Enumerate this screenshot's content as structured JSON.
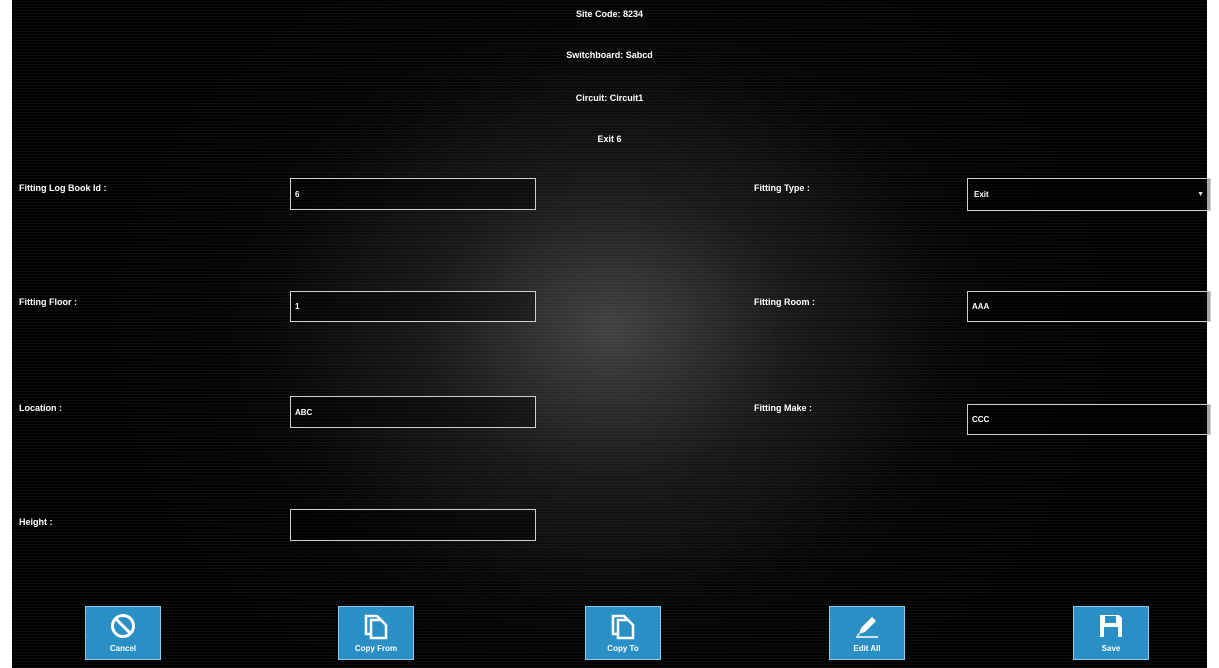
{
  "header": {
    "site_code": "Site Code: 8234",
    "switchboard": "Switchboard: Sabcd",
    "circuit": "Circuit: Circuit1",
    "fitting_name": "Exit 6"
  },
  "fields": {
    "fitting_log_book_id": {
      "label": "Fitting Log Book Id :",
      "value": "6"
    },
    "fitting_type": {
      "label": "Fitting Type :",
      "value": "Exit"
    },
    "fitting_floor": {
      "label": "Fitting Floor :",
      "value": "1"
    },
    "fitting_room": {
      "label": "Fitting Room :",
      "value": "AAA"
    },
    "location": {
      "label": "Location :",
      "value": "ABC"
    },
    "fitting_make": {
      "label": "Fitting Make :",
      "value": "CCC"
    },
    "height": {
      "label": "Height :",
      "value": ""
    }
  },
  "actions": {
    "cancel": {
      "label": "Cancel",
      "icon": "cancel-icon"
    },
    "copy_from": {
      "label": "Copy From",
      "icon": "copy-icon"
    },
    "copy_to": {
      "label": "Copy To",
      "icon": "copy-icon"
    },
    "edit_all": {
      "label": "Edit All",
      "icon": "pencil-icon"
    },
    "save": {
      "label": "Save",
      "icon": "floppy-disk-icon"
    }
  },
  "colors": {
    "button_background": "#2a8fc4",
    "button_border": "#8ecbe9",
    "background": "#000000",
    "input_border": "#cfcfcf"
  }
}
